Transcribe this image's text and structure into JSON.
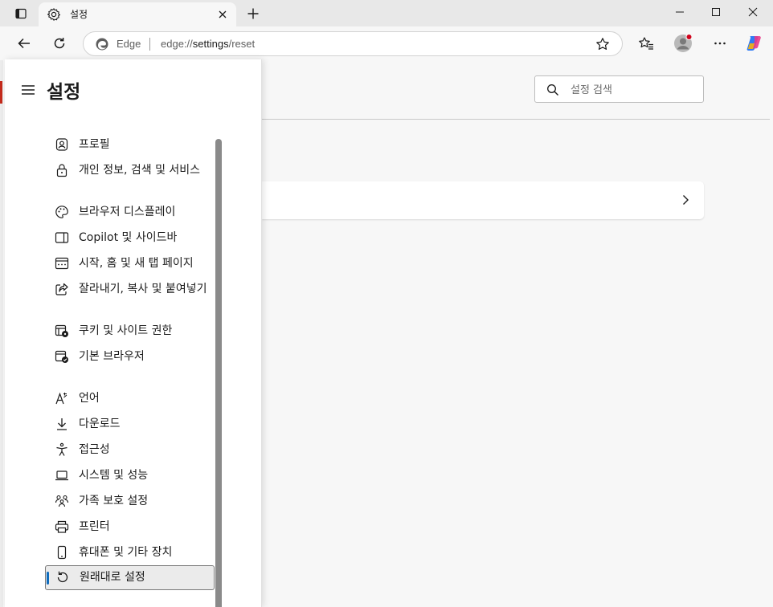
{
  "browser": {
    "tab": {
      "title": "설정",
      "icon": "gear-icon"
    },
    "address": {
      "brand": "Edge",
      "url_scheme": "edge://",
      "url_host": "settings",
      "url_path": "/reset"
    },
    "toolbar_icons": [
      "back-arrow-icon",
      "refresh-icon",
      "favorites-icon",
      "profile-avatar-icon",
      "more-menu-icon",
      "copilot-icon"
    ]
  },
  "settings": {
    "title": "설정",
    "search": {
      "placeholder": "설정 검색",
      "value": ""
    },
    "nav": [
      {
        "label": "프로필",
        "icon": "profile-icon"
      },
      {
        "label": "개인 정보, 검색 및 서비스",
        "icon": "privacy-lock-icon"
      },
      {
        "label": "브라우저 디스플레이",
        "icon": "palette-icon"
      },
      {
        "label": "Copilot 및 사이드바",
        "icon": "sidebar-icon"
      },
      {
        "label": "시작, 홈 및 새 탭 페이지",
        "icon": "start-page-icon"
      },
      {
        "label": "잘라내기, 복사 및 붙여넣기",
        "icon": "share-icon"
      },
      {
        "label": "쿠키 및 사이트 권한",
        "icon": "cookie-permissions-icon"
      },
      {
        "label": "기본 브라우저",
        "icon": "default-browser-icon"
      },
      {
        "label": "언어",
        "icon": "language-icon"
      },
      {
        "label": "다운로드",
        "icon": "download-icon"
      },
      {
        "label": "접근성",
        "icon": "accessibility-icon"
      },
      {
        "label": "시스템 및 성능",
        "icon": "laptop-icon"
      },
      {
        "label": "가족 보호 설정",
        "icon": "family-icon"
      },
      {
        "label": "프린터",
        "icon": "printer-icon"
      },
      {
        "label": "휴대폰 및 기타 장치",
        "icon": "phone-icon"
      },
      {
        "label": "원래대로 설정",
        "icon": "reset-icon",
        "active": true
      }
    ]
  },
  "colors": {
    "accent": "#0f6cbd",
    "active_bg": "#ebebeb",
    "window_bg": "#f7f7f7"
  }
}
